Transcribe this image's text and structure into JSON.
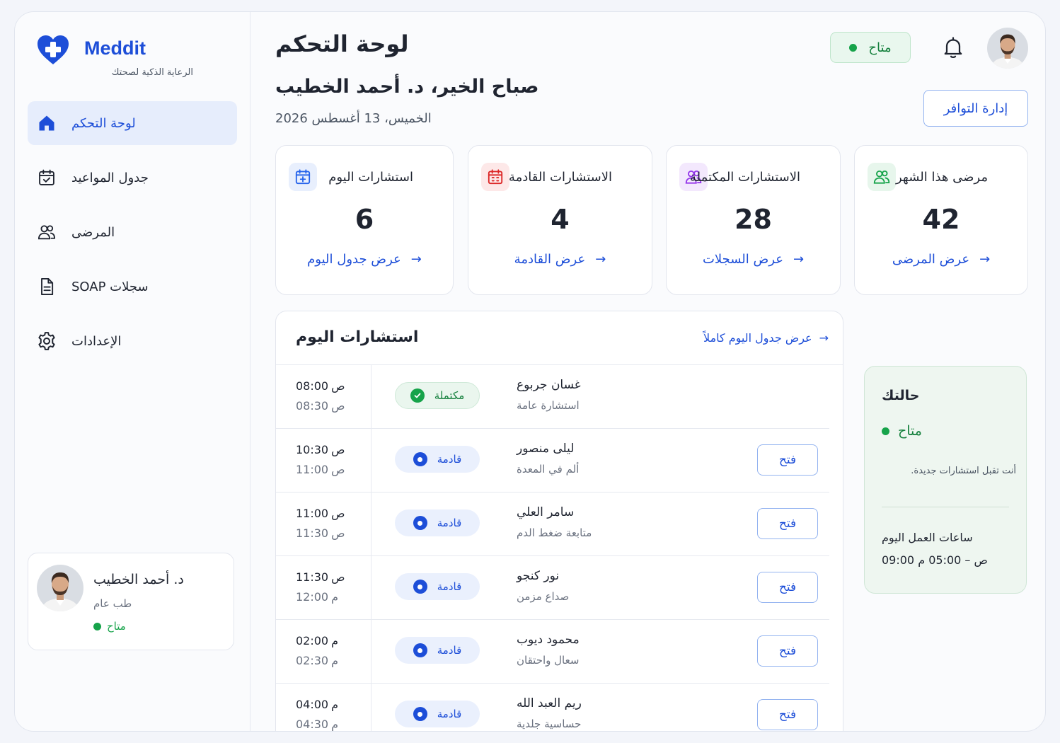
{
  "brand": {
    "name": "Meddit",
    "tagline": "الرعاية الذكية لصحتك"
  },
  "nav": [
    {
      "label": "لوحة التحكم",
      "icon": "home-icon",
      "active": true
    },
    {
      "label": "جدول المواعيد",
      "icon": "calendar-icon"
    },
    {
      "label": "المرضى",
      "icon": "users-icon"
    },
    {
      "label": "سجلات SOAP",
      "icon": "document-icon"
    },
    {
      "label": "الإعدادات",
      "icon": "gear-icon"
    }
  ],
  "profile": {
    "name": "د. أحمد الخطيب",
    "specialty": "طب عام",
    "status": "متاح"
  },
  "header": {
    "title": "لوحة التحكم",
    "availability": "متاح",
    "greeting": "صباح الخير، د. أحمد الخطيب",
    "date": "الخميس، 13 أغسطس 2026",
    "manage_button": "إدارة التوافر"
  },
  "stats": [
    {
      "title": "استشارات اليوم",
      "value": "6",
      "link": "عرض جدول اليوم",
      "icon": "calendar-plus-icon",
      "color": "#2563eb"
    },
    {
      "title": "الاستشارات القادمة",
      "value": "4",
      "link": "عرض القادمة",
      "icon": "calendar-clock-icon",
      "color": "#dc2626"
    },
    {
      "title": "الاستشارات المكتملة",
      "value": "28",
      "link": "عرض السجلات",
      "icon": "users-icon",
      "color": "#9333ea"
    },
    {
      "title": "مرضى هذا الشهر",
      "value": "42",
      "link": "عرض المرضى",
      "icon": "users-icon",
      "color": "#16a34a"
    }
  ],
  "appointments": {
    "title": "استشارات اليوم",
    "view_all": "عرض جدول اليوم كاملاً",
    "open_label": "فتح",
    "rows": [
      {
        "start": "08:00",
        "start_unit": "ص",
        "end": "08:30",
        "end_unit": "ص",
        "status": "مكتملة",
        "done": true,
        "patient": "غسان جربوع",
        "reason": "استشارة عامة"
      },
      {
        "start": "10:30",
        "start_unit": "ص",
        "end": "11:00",
        "end_unit": "ص",
        "status": "قادمة",
        "done": false,
        "patient": "ليلى منصور",
        "reason": "ألم في المعدة"
      },
      {
        "start": "11:00",
        "start_unit": "ص",
        "end": "11:30",
        "end_unit": "ص",
        "status": "قادمة",
        "done": false,
        "patient": "سامر العلي",
        "reason": "متابعة ضغط الدم"
      },
      {
        "start": "11:30",
        "start_unit": "ص",
        "end": "12:00",
        "end_unit": "م",
        "status": "قادمة",
        "done": false,
        "patient": "نور كنجو",
        "reason": "صداع مزمن"
      },
      {
        "start": "02:00",
        "start_unit": "م",
        "end": "02:30",
        "end_unit": "م",
        "status": "قادمة",
        "done": false,
        "patient": "محمود ديوب",
        "reason": "سعال واحتقان"
      },
      {
        "start": "04:00",
        "start_unit": "م",
        "end": "04:30",
        "end_unit": "م",
        "status": "قادمة",
        "done": false,
        "patient": "ريم العبد الله",
        "reason": "حساسية جلدية"
      }
    ]
  },
  "status_card": {
    "title": "حالتك",
    "status": "متاح",
    "description": "أنت تقبل استشارات جديدة.",
    "hours_title": "ساعات العمل اليوم",
    "hours": "09:00 ص – 05:00 م"
  }
}
